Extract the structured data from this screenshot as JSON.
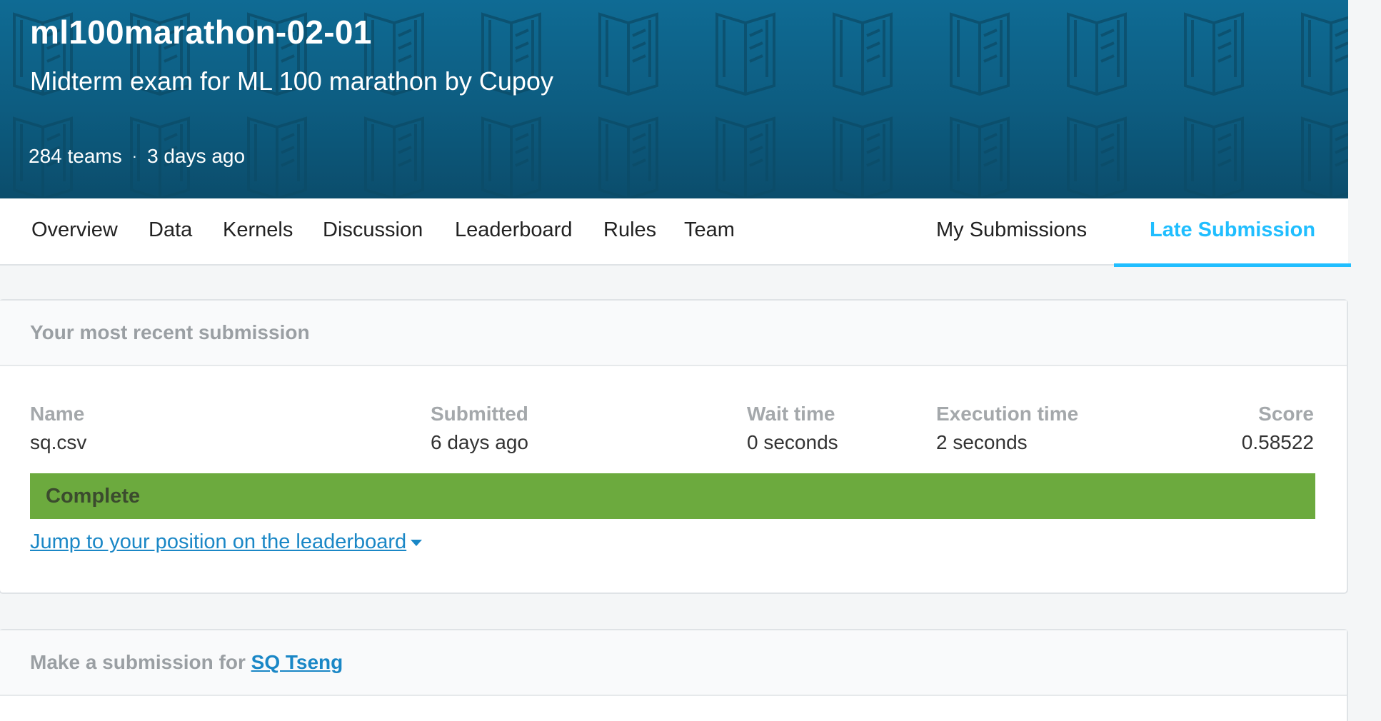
{
  "competition": {
    "title": "ml100marathon-02-01",
    "subtitle": "Midterm exam for ML 100 marathon by Cupoy",
    "teams": "284 teams",
    "separator": "·",
    "age": "3 days ago"
  },
  "tabs": [
    {
      "label": "Overview"
    },
    {
      "label": "Data"
    },
    {
      "label": "Kernels"
    },
    {
      "label": "Discussion"
    },
    {
      "label": "Leaderboard"
    },
    {
      "label": "Rules"
    },
    {
      "label": "Team"
    },
    {
      "label": "My Submissions"
    },
    {
      "label": "Late Submission",
      "active": true
    }
  ],
  "recent": {
    "heading": "Your most recent submission",
    "columns": {
      "name": {
        "label": "Name",
        "value": "sq.csv"
      },
      "submitted": {
        "label": "Submitted",
        "value": "6 days ago"
      },
      "wait": {
        "label": "Wait time",
        "value": "0 seconds"
      },
      "execution": {
        "label": "Execution time",
        "value": "2 seconds"
      },
      "score": {
        "label": "Score",
        "value": "0.58522"
      }
    },
    "status": "Complete",
    "jump_link": "Jump to your position on the leaderboard"
  },
  "make_submission": {
    "prefix": "Make a submission for",
    "team_name": "SQ Tseng"
  },
  "colors": {
    "banner": "#0d5c80",
    "accent": "#20beff",
    "complete": "#6caa3e",
    "link": "#1a87c6"
  }
}
